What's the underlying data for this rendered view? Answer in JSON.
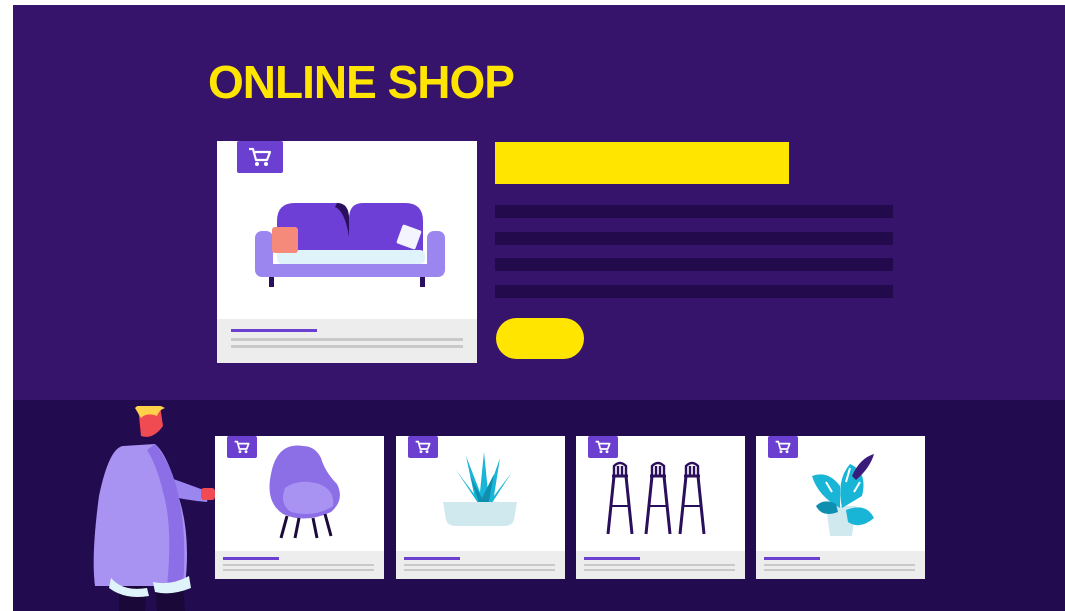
{
  "header": {
    "title": "ONLINE SHOP"
  },
  "colors": {
    "hero_bg": "#36146b",
    "bottom_bg": "#230b4f",
    "accent_yellow": "#ffe500",
    "accent_purple": "#6b3fd0"
  },
  "featured_product": {
    "icon": "sofa-icon",
    "badge_icon": "shopping-cart-icon"
  },
  "products": [
    {
      "icon": "egg-chair-icon",
      "badge_icon": "shopping-cart-icon"
    },
    {
      "icon": "potted-plant-icon",
      "badge_icon": "shopping-cart-icon"
    },
    {
      "icon": "bar-stools-icon",
      "badge_icon": "shopping-cart-icon"
    },
    {
      "icon": "monstera-plant-icon",
      "badge_icon": "shopping-cart-icon"
    }
  ],
  "illustration": {
    "icon": "person-pointing-illustration"
  }
}
